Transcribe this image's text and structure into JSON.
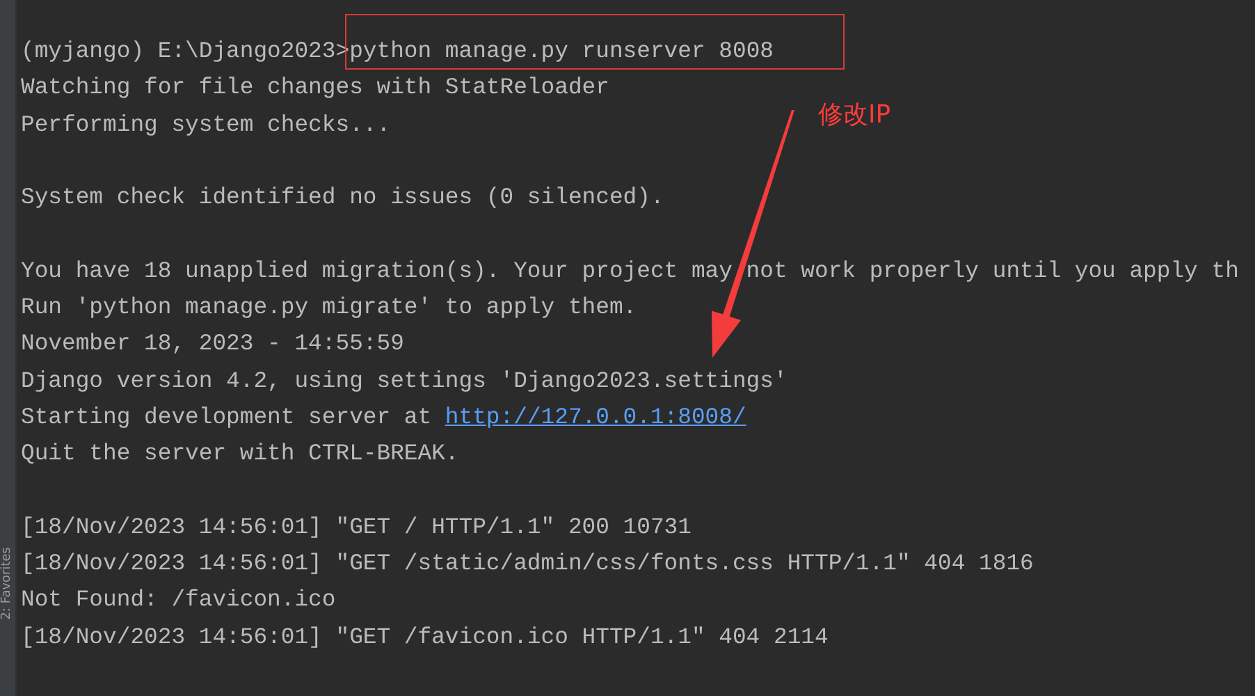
{
  "sidebar": {
    "tab_label": "2: Favorites"
  },
  "terminal": {
    "lines": [
      {
        "kind": "prompt",
        "prompt": "(myjango) E:\\Django2023>",
        "command": "python manage.py runserver 8008"
      },
      {
        "kind": "text",
        "text": "Watching for file changes with StatReloader"
      },
      {
        "kind": "text",
        "text": "Performing system checks..."
      },
      {
        "kind": "blank"
      },
      {
        "kind": "text",
        "text": "System check identified no issues (0 silenced)."
      },
      {
        "kind": "blank"
      },
      {
        "kind": "text",
        "text": "You have 18 unapplied migration(s). Your project may not work properly until you apply th"
      },
      {
        "kind": "text",
        "text": "Run 'python manage.py migrate' to apply them."
      },
      {
        "kind": "text",
        "text": "November 18, 2023 - 14:55:59"
      },
      {
        "kind": "text",
        "text": "Django version 4.2, using settings 'Django2023.settings'"
      },
      {
        "kind": "link",
        "text": "Starting development server at ",
        "link": "http://127.0.0.1:8008/"
      },
      {
        "kind": "text",
        "text": "Quit the server with CTRL-BREAK."
      },
      {
        "kind": "blank"
      },
      {
        "kind": "text",
        "text": "[18/Nov/2023 14:56:01] \"GET / HTTP/1.1\" 200 10731"
      },
      {
        "kind": "text",
        "text": "[18/Nov/2023 14:56:01] \"GET /static/admin/css/fonts.css HTTP/1.1\" 404 1816"
      },
      {
        "kind": "text",
        "text": "Not Found: /favicon.ico"
      },
      {
        "kind": "text",
        "text": "[18/Nov/2023 14:56:01] \"GET /favicon.ico HTTP/1.1\" 404 2114"
      }
    ]
  },
  "annotation": {
    "label": "修改IP"
  }
}
